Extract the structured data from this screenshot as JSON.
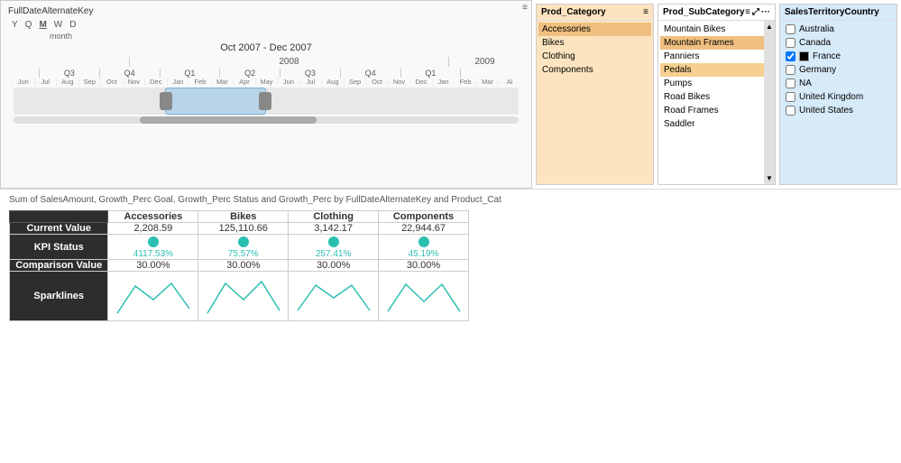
{
  "timeline": {
    "title": "FullDateAlternateKey",
    "controls": [
      "Y",
      "Q",
      "M",
      "W",
      "D"
    ],
    "active_control": "M",
    "unit": "month",
    "selected_range": "Oct 2007 - Dec 2007",
    "years": [
      "2008",
      "2009"
    ],
    "quarters_2008": [
      "Q1",
      "Q2",
      "Q3",
      "Q4"
    ],
    "quarters_2009": [
      "Q1"
    ],
    "months": [
      "Jun",
      "Jul",
      "Aug",
      "Sep",
      "Oct",
      "Nov",
      "Dec",
      "Jan",
      "Feb",
      "Mar",
      "Apr",
      "May",
      "Jun",
      "Jul",
      "Aug",
      "Sep",
      "Oct",
      "Nov",
      "Dec",
      "Jan",
      "Feb",
      "Mar",
      "Al"
    ]
  },
  "prod_category": {
    "title": "Prod_Category",
    "items": [
      "Accessories",
      "Bikes",
      "Clothing",
      "Components"
    ],
    "selected": "Accessories"
  },
  "prod_subcategory": {
    "title": "Prod_SubCategory",
    "items": [
      "Mountain Bikes",
      "Mountain Frames",
      "Panniers",
      "Pedals",
      "Pumps",
      "Road Bikes",
      "Road Frames",
      "Saddler"
    ],
    "selected": "Mountain Frames",
    "highlighted": "Pedals"
  },
  "territory": {
    "title": "SalesTerritoryCountry",
    "items": [
      {
        "label": "Australia",
        "checked": false,
        "color": ""
      },
      {
        "label": "Canada",
        "checked": false,
        "color": ""
      },
      {
        "label": "France",
        "checked": true,
        "color": "black"
      },
      {
        "label": "Germany",
        "checked": false,
        "color": ""
      },
      {
        "label": "NA",
        "checked": false,
        "color": ""
      },
      {
        "label": "United Kingdom",
        "checked": false,
        "color": ""
      },
      {
        "label": "United States",
        "checked": false,
        "color": ""
      }
    ]
  },
  "table": {
    "subtitle": "Sum of SalesAmount, Growth_Perc Goal, Growth_Perc Status and Growth_Perc by FullDateAlternateKey and Product_Cat",
    "columns": [
      "Accessories",
      "Bikes",
      "Clothing",
      "Components"
    ],
    "rows": [
      {
        "metric": "Current Value",
        "values": [
          "2,208.59",
          "125,110.66",
          "3,142.17",
          "22,944.67"
        ]
      },
      {
        "metric": "KPI Status",
        "kpi_values": [
          "4117.53%",
          "75.57%",
          "257.41%",
          "45.19%"
        ]
      },
      {
        "metric": "Comparison Value",
        "values": [
          "30.00%",
          "30.00%",
          "30.00%",
          "30.00%"
        ]
      },
      {
        "metric": "Sparklines",
        "type": "sparklines"
      }
    ]
  },
  "icons": {
    "menu": "≡",
    "expand": "⤢",
    "more": "...",
    "scroll_down": "▾",
    "scroll_up": "▴"
  }
}
